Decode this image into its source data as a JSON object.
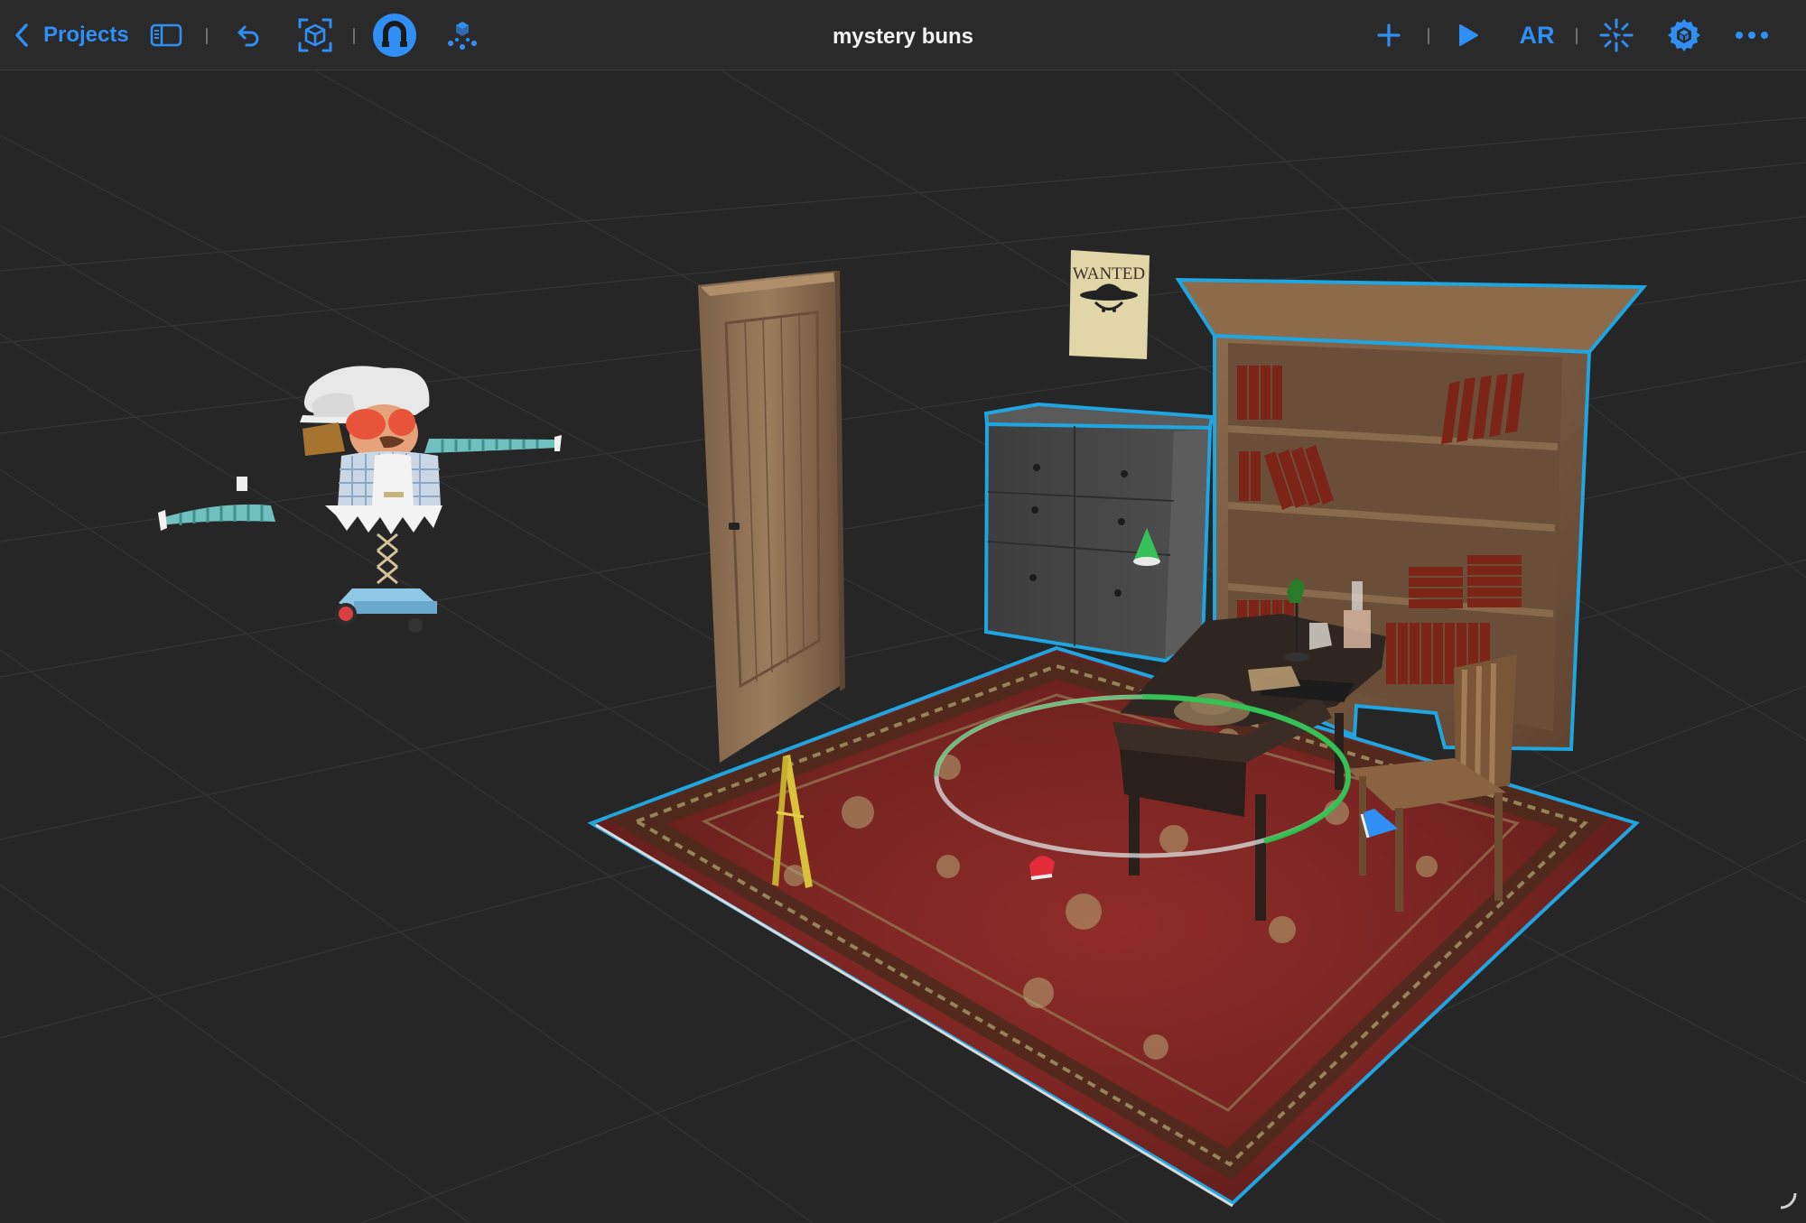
{
  "toolbar": {
    "back_label": "Projects",
    "title": "mystery buns",
    "ar_label": "AR",
    "icons": [
      "chevron-left-icon",
      "sidebar-icon",
      "undo-icon",
      "focus-cube-icon",
      "magnet-icon",
      "physics-icon",
      "plus-icon",
      "play-icon",
      "anchor-icon",
      "settings-icon",
      "more-icon"
    ],
    "accent_color": "#2f8ff5",
    "active_color": "#2f8ff5"
  },
  "scene": {
    "poster_text": "WANTED",
    "selection_color": "#1fa6e0",
    "rotation_gizmo_color": "#27c24c",
    "background_color": "#262626"
  }
}
